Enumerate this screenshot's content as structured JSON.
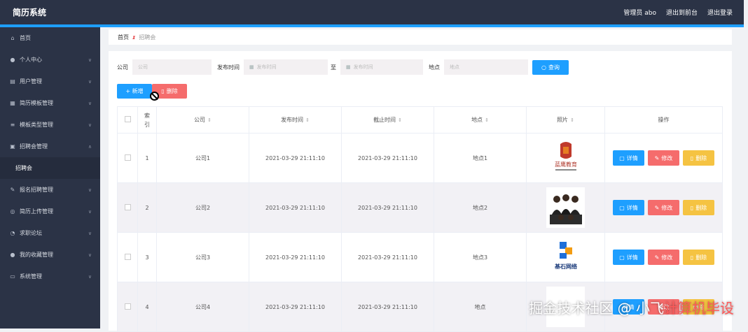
{
  "app": {
    "title": "简历系统"
  },
  "topbar": {
    "user": "管理员 abo",
    "back_to_front": "退出到前台",
    "logout": "退出登录"
  },
  "sidebar": {
    "items": [
      {
        "label": "首页",
        "icon": "home-icon"
      },
      {
        "label": "个人中心",
        "icon": "user-icon"
      },
      {
        "label": "用户管理",
        "icon": "list-icon"
      },
      {
        "label": "简历模板管理",
        "icon": "grid-icon"
      },
      {
        "label": "模板类型管理",
        "icon": "stack-icon"
      },
      {
        "label": "招聘会管理",
        "icon": "doc-icon"
      },
      {
        "label": "招聘会",
        "icon": ""
      },
      {
        "label": "报名招聘管理",
        "icon": "note-icon"
      },
      {
        "label": "简历上传管理",
        "icon": "upload-icon"
      },
      {
        "label": "求职论坛",
        "icon": "chat-icon"
      },
      {
        "label": "我的收藏管理",
        "icon": "user-icon"
      },
      {
        "label": "系统管理",
        "icon": "message-icon"
      }
    ]
  },
  "breadcrumb": {
    "home": "首页",
    "current": "招聘会"
  },
  "search": {
    "company_label": "公司",
    "company_placeholder": "公司",
    "time_label": "发布时间",
    "start_placeholder": "发布时间",
    "to_label": "至",
    "end_placeholder": "发布时间",
    "place_label": "地点",
    "place_placeholder": "地点",
    "query_button": "查询"
  },
  "actions": {
    "add": "+ 新增",
    "delete": "删除"
  },
  "table": {
    "headers": [
      "索引",
      "公司",
      "发布时间",
      "截止时间",
      "地点",
      "照片",
      "操作"
    ],
    "rows": [
      {
        "index": "1",
        "company": "公司1",
        "publish": "2021-03-29 21:11:10",
        "deadline": "2021-03-29 21:11:10",
        "place": "地点1"
      },
      {
        "index": "2",
        "company": "公司2",
        "publish": "2021-03-29 21:11:10",
        "deadline": "2021-03-29 21:11:10",
        "place": "地点2"
      },
      {
        "index": "3",
        "company": "公司3",
        "publish": "2021-03-29 21:11:10",
        "deadline": "2021-03-29 21:11:10",
        "place": "地点3"
      },
      {
        "index": "4",
        "company": "公司4",
        "publish": "2021-03-29 21:11:10",
        "deadline": "2021-03-29 21:11:10",
        "place": "地点"
      }
    ],
    "ops": {
      "detail": "详情",
      "edit": "修改",
      "delete": "删除"
    }
  },
  "photos": {
    "row1_logo_text": "蓝鹰教育",
    "row3_logo_text": "基石网络"
  },
  "watermark": {
    "part1": "掘金技术社区 @ 小飞",
    "part2": "计算机毕设"
  },
  "colors": {
    "sidebar": "#2b3346",
    "accent": "#1e9fff",
    "danger": "#f56c6c",
    "warning": "#f5c342"
  }
}
